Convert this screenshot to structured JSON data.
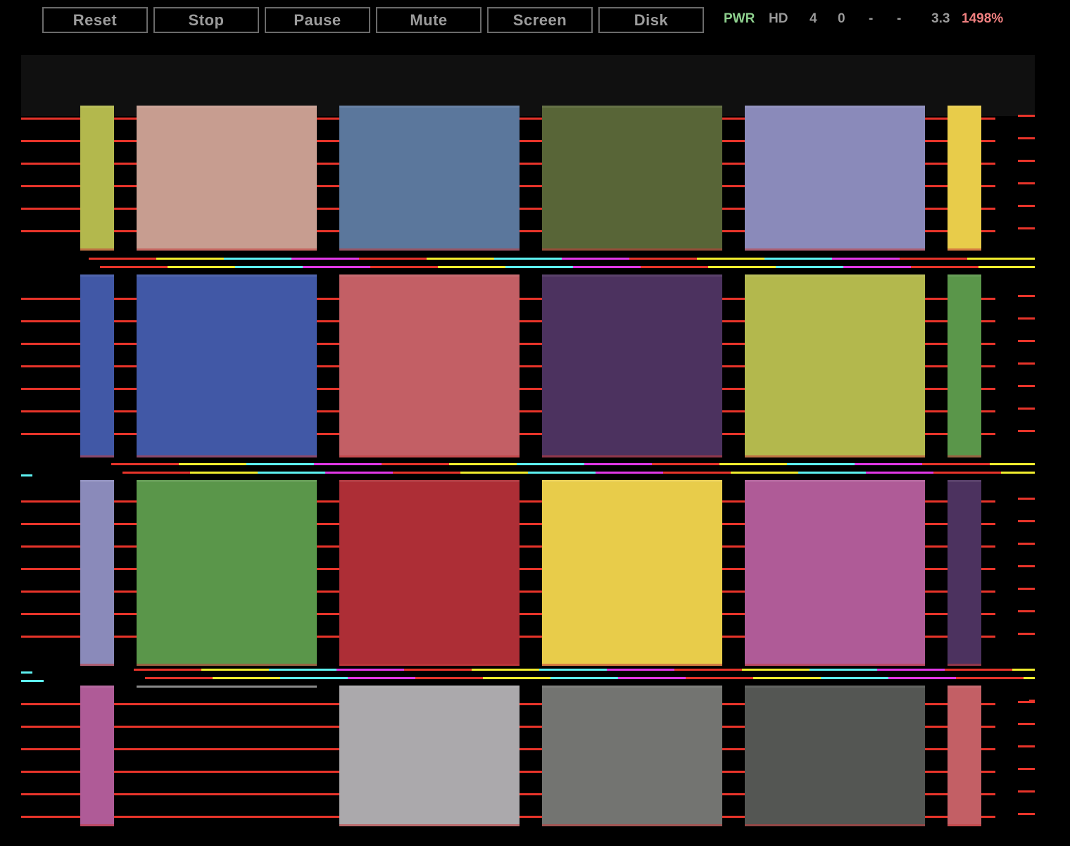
{
  "toolbar": {
    "buttons": [
      "Reset",
      "Stop",
      "Pause",
      "Mute",
      "Screen",
      "Disk"
    ]
  },
  "status": {
    "pwr": "PWR",
    "hd": "HD",
    "val1": "4",
    "val2": "0",
    "val3": "-",
    "val4": "-",
    "voltage": "3.3",
    "speed": "1498%",
    "colors": {
      "pwr": "#8ed08e",
      "default": "#9a9a9a",
      "speed": "#f08080"
    }
  },
  "screen": {
    "background": "#000000",
    "header_band_color": "#101010",
    "line_colors": [
      "#e8342a",
      "#f2ee2e",
      "#5ef2f2",
      "#e238e8"
    ],
    "rows": [
      [
        "#b3b84d",
        "#c79d90",
        "#5b779c",
        "#586537",
        "#8a8aba",
        "#e8cc4a"
      ],
      [
        "#4158a6",
        "#4158a6",
        "#c35f65",
        "#4c325f",
        "#b3b84d",
        "#5a964a"
      ],
      [
        "#8a8aba",
        "#5a964a",
        "#ad2e36",
        "#e8cc4a",
        "#af5b97",
        "#4c325f"
      ],
      [
        "#af5b97",
        "#000000",
        "#aba9ac",
        "#737471",
        "#545653",
        "#c35f65"
      ]
    ]
  }
}
